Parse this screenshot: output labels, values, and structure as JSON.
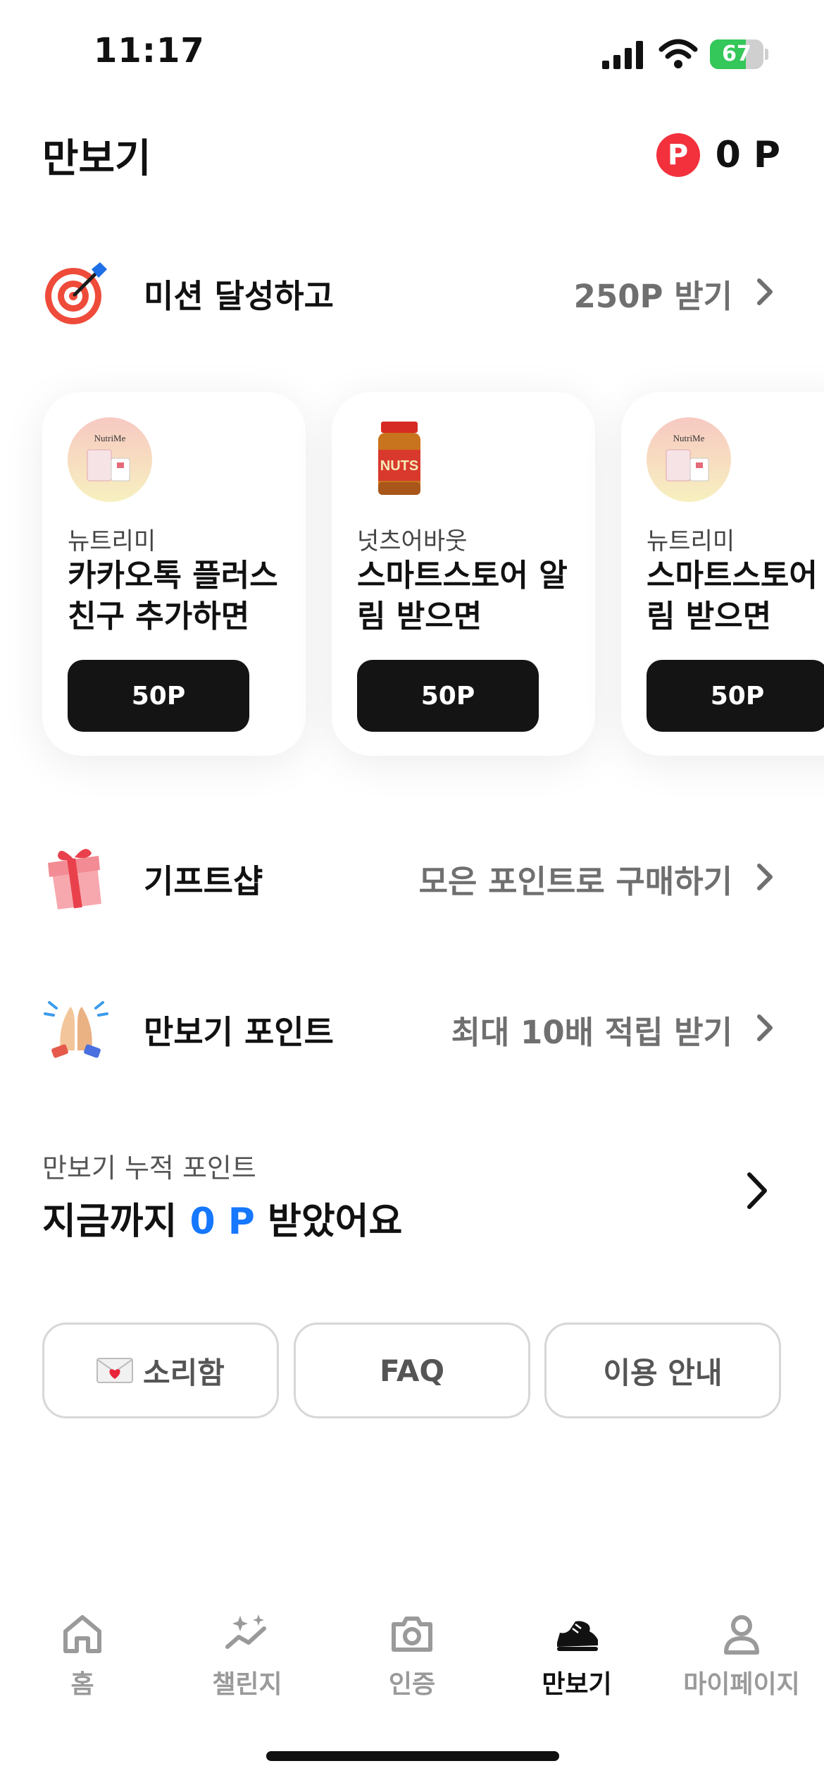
{
  "status_bar": {
    "time": "11:17",
    "battery": "67",
    "battery_level": 0.67
  },
  "header": {
    "title": "만보기",
    "points_icon_letter": "P",
    "points_value": "0 P"
  },
  "mission_row": {
    "label": "미션 달성하고",
    "action": "250P 받기",
    "icon": "target-icon"
  },
  "missions": [
    {
      "brand": "뉴트리미",
      "text": "카카오톡 플러스 친구 추가하면",
      "reward": "50P",
      "logo": "nutrime-logo"
    },
    {
      "brand": "넛츠어바웃",
      "text": "스마트스토어 알림 받으면",
      "reward": "50P",
      "logo": "peanut-butter-jar"
    },
    {
      "brand": "뉴트리미",
      "text": "스마트스토어 알림 받으면",
      "reward": "50P",
      "logo": "nutrime-logo"
    }
  ],
  "brand_logo_text": "NutriMe",
  "jar_label_text": "NUTS",
  "gift_row": {
    "label": "기프트샵",
    "action": "모은 포인트로 구매하기",
    "icon": "gift-icon"
  },
  "pedometer_row": {
    "label": "만보기 포인트",
    "action": "최대 10배 적립 받기",
    "icon": "high-five-icon"
  },
  "cumulative": {
    "label": "만보기 누적 포인트",
    "prefix": "지금까지 ",
    "value": "0 P",
    "suffix": " 받았어요"
  },
  "footer_buttons": [
    {
      "label": "소리함",
      "icon": "envelope-heart-icon"
    },
    {
      "label": "FAQ"
    },
    {
      "label": "이용 안내"
    }
  ],
  "tabs": [
    {
      "label": "홈",
      "icon": "home-icon",
      "active": false
    },
    {
      "label": "챌린지",
      "icon": "sparkle-chart-icon",
      "active": false
    },
    {
      "label": "인증",
      "icon": "camera-icon",
      "active": false
    },
    {
      "label": "만보기",
      "icon": "sneaker-icon",
      "active": true
    },
    {
      "label": "마이페이지",
      "icon": "person-icon",
      "active": false
    }
  ],
  "colors": {
    "accent_blue": "#1677ff",
    "points_red": "#f2313d",
    "button_black": "#141414",
    "battery_green": "#34c759"
  }
}
